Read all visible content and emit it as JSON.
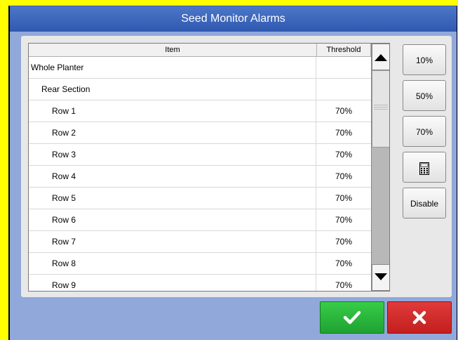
{
  "window": {
    "title": "Seed Monitor Alarms"
  },
  "table": {
    "headers": {
      "item": "Item",
      "threshold": "Threshold"
    },
    "rows": [
      {
        "label": "Whole Planter",
        "threshold": ""
      },
      {
        "label": "Rear Section",
        "threshold": ""
      },
      {
        "label": "Row 1",
        "threshold": "70%"
      },
      {
        "label": "Row 2",
        "threshold": "70%"
      },
      {
        "label": "Row 3",
        "threshold": "70%"
      },
      {
        "label": "Row 4",
        "threshold": "70%"
      },
      {
        "label": "Row 5",
        "threshold": "70%"
      },
      {
        "label": "Row 6",
        "threshold": "70%"
      },
      {
        "label": "Row 7",
        "threshold": "70%"
      },
      {
        "label": "Row 8",
        "threshold": "70%"
      },
      {
        "label": "Row 9",
        "threshold": "70%"
      }
    ]
  },
  "side_buttons": {
    "b10": "10%",
    "b50": "50%",
    "b70": "70%",
    "calculator_icon": "calculator-icon",
    "disable": "Disable"
  },
  "icons": {
    "scroll_up": "up-arrow-icon",
    "scroll_down": "down-arrow-icon",
    "confirm": "checkmark-icon",
    "cancel": "close-icon"
  },
  "colors": {
    "titlebar": "#3a62b8",
    "window_bg": "#90a8da",
    "confirm": "#28b83a",
    "cancel": "#d02a2a"
  }
}
